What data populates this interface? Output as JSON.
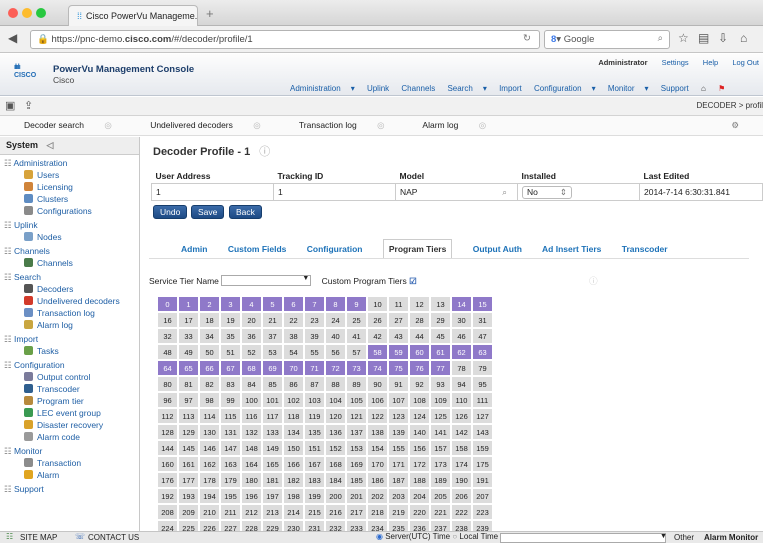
{
  "browser": {
    "tab_title": "Cisco PowerVu Manageme...",
    "url_prefix": "https://pnc-demo.",
    "url_host": "cisco.com",
    "url_path": "/#/decoder/profile/1",
    "search_engine": "Google"
  },
  "app": {
    "logo_text": "cisco",
    "title": "PowerVu Management Console",
    "subtitle": "Cisco",
    "user_links": [
      "Administrator",
      "Settings",
      "Help",
      "Log Out"
    ],
    "nav": [
      "Administration",
      "Uplink",
      "Channels",
      "Search",
      "Import",
      "Configuration",
      "Monitor",
      "Support"
    ],
    "breadcrumb": "DECODER  >  profil"
  },
  "subnav": [
    "Decoder search",
    "Undelivered decoders",
    "Transaction log",
    "Alarm log"
  ],
  "sidebar": {
    "title": "System",
    "sections": [
      {
        "label": "Administration",
        "items": [
          {
            "label": "Users",
            "color": "#d7a33b"
          },
          {
            "label": "Licensing",
            "color": "#d0843a"
          },
          {
            "label": "Clusters",
            "color": "#5e8cc2"
          },
          {
            "label": "Configurations",
            "color": "#8a8a8a"
          }
        ]
      },
      {
        "label": "Uplink",
        "items": [
          {
            "label": "Nodes",
            "color": "#7aa0c8"
          }
        ]
      },
      {
        "label": "Channels",
        "items": [
          {
            "label": "Channels",
            "color": "#4a7b4a"
          }
        ]
      },
      {
        "label": "Search",
        "items": [
          {
            "label": "Decoders",
            "color": "#555555"
          },
          {
            "label": "Undelivered decoders",
            "color": "#d23a2a"
          },
          {
            "label": "Transaction log",
            "color": "#6b8fc4"
          },
          {
            "label": "Alarm log",
            "color": "#c9a640"
          }
        ]
      },
      {
        "label": "Import",
        "items": [
          {
            "label": "Tasks",
            "color": "#6aa048"
          }
        ]
      },
      {
        "label": "Configuration",
        "items": [
          {
            "label": "Output control",
            "color": "#7b7b9b"
          },
          {
            "label": "Transcoder",
            "color": "#2f5f8f"
          },
          {
            "label": "Program tier",
            "color": "#b78a3d"
          },
          {
            "label": "LEC event group",
            "color": "#3a9a52"
          },
          {
            "label": "Disaster recovery",
            "color": "#d9a22a"
          },
          {
            "label": "Alarm code",
            "color": "#9a9a9a"
          }
        ]
      },
      {
        "label": "Monitor",
        "items": [
          {
            "label": "Transaction",
            "color": "#8c8c8c"
          },
          {
            "label": "Alarm",
            "color": "#e0a520"
          }
        ]
      },
      {
        "label": "Support",
        "items": []
      }
    ]
  },
  "page": {
    "title": "Decoder Profile - 1",
    "columns": [
      "User Address",
      "Tracking ID",
      "Model",
      "Installed",
      "Last Edited"
    ],
    "row": {
      "user_address": "1",
      "tracking_id": "1",
      "model": "NAP",
      "installed": "No",
      "last_edited": "2014-7-14 6:30:31.841"
    },
    "buttons": [
      "Undo",
      "Save",
      "Back"
    ],
    "tabs": [
      "Admin",
      "Custom Fields",
      "Configuration",
      "Program Tiers",
      "Output Auth",
      "Ad Insert Tiers",
      "Transcoder"
    ],
    "active_tab": "Program Tiers",
    "service_tier_label": "Service Tier Name",
    "custom_tiers_label": "Custom Program Tiers",
    "custom_tiers_checked": true
  },
  "tiers": {
    "count": 256,
    "selected": [
      0,
      1,
      2,
      3,
      4,
      5,
      6,
      7,
      8,
      9,
      14,
      15,
      58,
      59,
      60,
      61,
      62,
      63,
      64,
      65,
      66,
      67,
      68,
      69,
      70,
      71,
      72,
      73,
      74,
      75,
      76,
      77
    ],
    "selected_color": "#8f79c9"
  },
  "bottombar": {
    "site_map": "SITE MAP",
    "contact": "CONTACT US",
    "time_server": "Server(UTC) Time",
    "time_local": "Local Time",
    "other": "Other",
    "monitor": "Alarm Monitor"
  }
}
